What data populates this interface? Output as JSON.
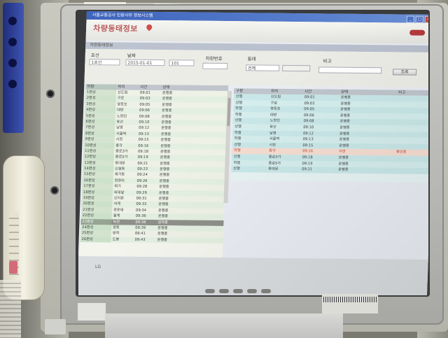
{
  "window": {
    "title": "서울교통공사 민원사무 정보시스템",
    "min": "_",
    "max": "□",
    "close": "×"
  },
  "header": {
    "page_title": "차량동태정보",
    "sub_title": "차량동태정보"
  },
  "filter": {
    "labels": {
      "line": "호선",
      "date": "날짜",
      "train": "차량번호",
      "status": "동태",
      "remark": "비고"
    },
    "values": {
      "line": "1호선",
      "date": "2015-01-01",
      "train": "101",
      "status": "전체",
      "remark": ""
    },
    "search_button": "조회"
  },
  "left_table": {
    "columns": [
      "차량",
      "위치",
      "시간",
      "상태"
    ],
    "rows": [
      [
        "1편성",
        "신도림",
        "09:01",
        "운행중"
      ],
      [
        "2편성",
        "구로",
        "09:03",
        "운행중"
      ],
      [
        "3편성",
        "영등포",
        "09:05",
        "운행중"
      ],
      [
        "4편성",
        "대방",
        "09:06",
        "운행중"
      ],
      [
        "5편성",
        "노량진",
        "09:08",
        "운행중"
      ],
      [
        "6편성",
        "용산",
        "09:10",
        "운행중"
      ],
      [
        "7편성",
        "남영",
        "09:12",
        "운행중"
      ],
      [
        "8편성",
        "서울역",
        "09:13",
        "운행중"
      ],
      [
        "9편성",
        "시청",
        "09:15",
        "운행중"
      ],
      [
        "10편성",
        "종각",
        "09:16",
        "운행중"
      ],
      [
        "11편성",
        "종로3가",
        "09:18",
        "운행중"
      ],
      [
        "12편성",
        "종로5가",
        "09:19",
        "운행중"
      ],
      [
        "13편성",
        "동대문",
        "09:21",
        "운행중"
      ],
      [
        "14편성",
        "신설동",
        "09:23",
        "운행중"
      ],
      [
        "15편성",
        "제기동",
        "09:24",
        "운행중"
      ],
      [
        "16편성",
        "청량리",
        "09:26",
        "운행중"
      ],
      [
        "17편성",
        "회기",
        "09:28",
        "운행중"
      ],
      [
        "18편성",
        "외대앞",
        "09:29",
        "운행중"
      ],
      [
        "19편성",
        "신이문",
        "09:31",
        "운행중"
      ],
      [
        "20편성",
        "석계",
        "09:33",
        "운행중"
      ],
      [
        "21편성",
        "광운대",
        "09:34",
        "운행중"
      ],
      [
        "22편성",
        "월계",
        "09:36",
        "운행중"
      ],
      [
        "23편성",
        "녹천",
        "09:38",
        "정차중"
      ],
      [
        "24편성",
        "창동",
        "09:39",
        "운행중"
      ],
      [
        "25편성",
        "방학",
        "09:41",
        "운행중"
      ],
      [
        "26편성",
        "도봉",
        "09:43",
        "운행중"
      ]
    ]
  },
  "right_table": {
    "columns": [
      "구분",
      "위치",
      "시간",
      "상태",
      "비고"
    ],
    "rows": [
      [
        "상행",
        "신도림",
        "09:01",
        "운행중",
        ""
      ],
      [
        "상행",
        "구로",
        "09:03",
        "운행중",
        ""
      ],
      [
        "하행",
        "영등포",
        "09:05",
        "운행중",
        ""
      ],
      [
        "하행",
        "대방",
        "09:06",
        "운행중",
        ""
      ],
      [
        "상행",
        "노량진",
        "09:08",
        "운행중",
        ""
      ],
      [
        "상행",
        "용산",
        "09:10",
        "운행중",
        ""
      ],
      [
        "하행",
        "남영",
        "09:12",
        "운행중",
        ""
      ],
      [
        "하행",
        "서울역",
        "09:13",
        "운행중",
        ""
      ],
      [
        "상행",
        "시청",
        "09:15",
        "운행중",
        ""
      ],
      [
        "하행",
        "종각",
        "09:16",
        "지연",
        "확인중"
      ],
      [
        "상행",
        "종로3가",
        "09:18",
        "운행중",
        ""
      ],
      [
        "하행",
        "종로5가",
        "09:19",
        "운행중",
        ""
      ],
      [
        "상행",
        "동대문",
        "09:21",
        "운행중",
        ""
      ]
    ]
  },
  "monitor": {
    "brand": "LG"
  }
}
